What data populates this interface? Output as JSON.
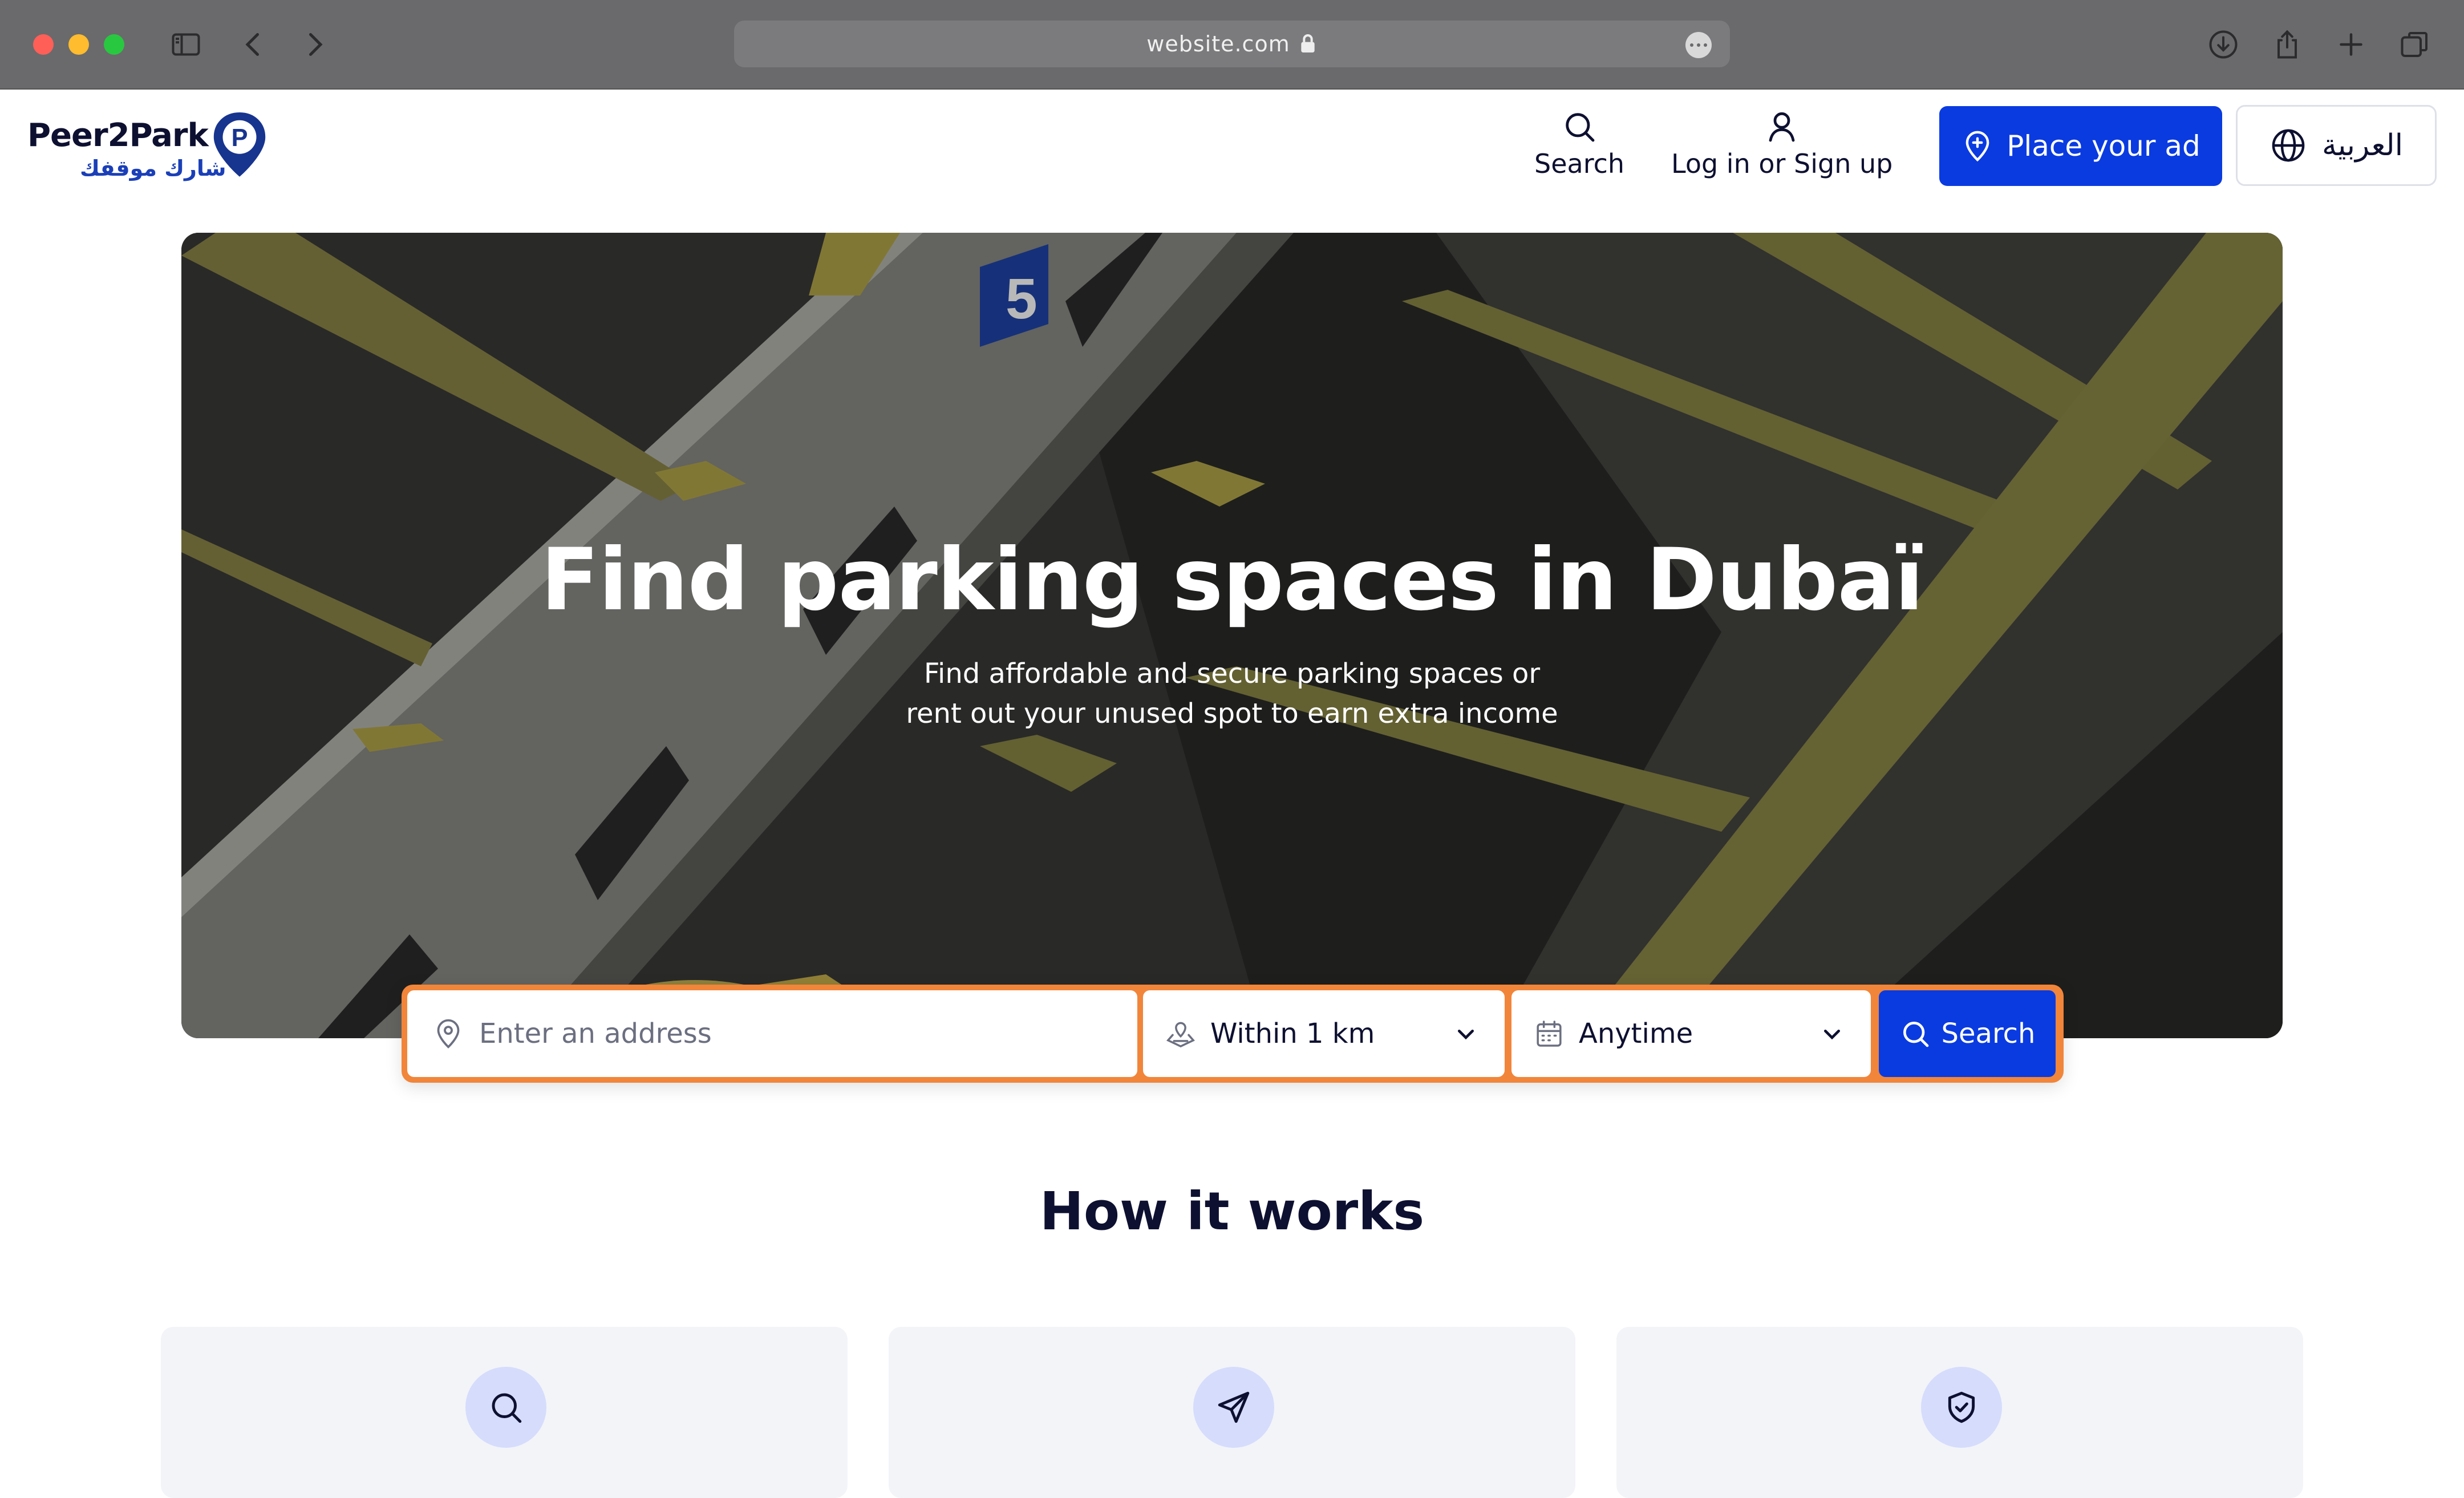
{
  "browser": {
    "url": "website.com",
    "icons": [
      "sidebar-icon",
      "back-icon",
      "forward-icon",
      "lock-icon",
      "more-icon",
      "download-icon",
      "share-icon",
      "new-tab-icon",
      "tabs-overview-icon"
    ]
  },
  "header": {
    "logo_text": "Peer2Park",
    "logo_arabic": "شارك موقفك",
    "logo_pin_letter": "P",
    "nav": {
      "search_label": "Search",
      "login_label": "Log in or Sign up"
    },
    "place_ad_label": "Place your ad",
    "language_label": "العربية"
  },
  "hero": {
    "title": "Find parking spaces in Dubaï",
    "subtitle_line1": "Find affordable and secure parking spaces or",
    "subtitle_line2": "rent out your unused spot to earn extra income",
    "image_sign_number": "5"
  },
  "search_form": {
    "address_placeholder": "Enter an address",
    "radius_value": "Within 1 km",
    "time_value": "Anytime",
    "submit_label": "Search"
  },
  "how_it_works": {
    "title": "How it works",
    "cards": [
      {
        "icon": "search-icon"
      },
      {
        "icon": "send-icon"
      },
      {
        "icon": "shield-check-icon"
      }
    ]
  },
  "colors": {
    "brand_blue": "#0a3be0",
    "highlight_orange": "#f1853a",
    "dark_text": "#0d1030",
    "icon_bubble": "#d6dcfc",
    "card_bg": "#f3f4f8"
  }
}
